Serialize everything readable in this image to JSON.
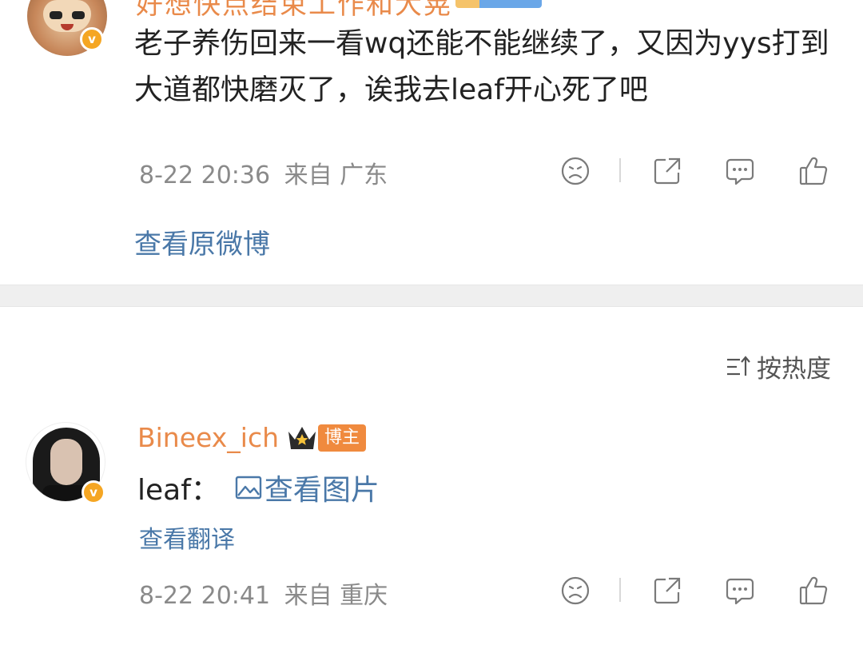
{
  "post": {
    "author_name_cut": "好想快点结束工作和大晃",
    "content": "老子养伤回来一看wq还能不能继续了，又因为yys打到大道都快磨灭了，诶我去leaf开心死了吧",
    "time": "8-22 20:36",
    "source": "来自 广东",
    "view_original": "查看原微博"
  },
  "comments": {
    "sort_label": "按热度",
    "items": [
      {
        "username": "Bineex_ich",
        "badge": "博主",
        "text_prefix": "leaf：",
        "image_link": "查看图片",
        "translate": "查看翻译",
        "time": "8-22 20:41",
        "source": "来自 重庆"
      }
    ]
  },
  "icons": {
    "verified": "v-badge-icon",
    "dislike": "sad-face-icon",
    "share": "share-icon",
    "comment": "comment-icon",
    "like": "thumbs-up-icon",
    "sort": "sort-icon",
    "image": "image-icon",
    "crown": "crown-icon"
  },
  "colors": {
    "username": "#e98a4a",
    "link": "#4a78a8",
    "meta": "#8a8a8a",
    "badge": "#f08a3e",
    "verified": "#f5a623"
  }
}
